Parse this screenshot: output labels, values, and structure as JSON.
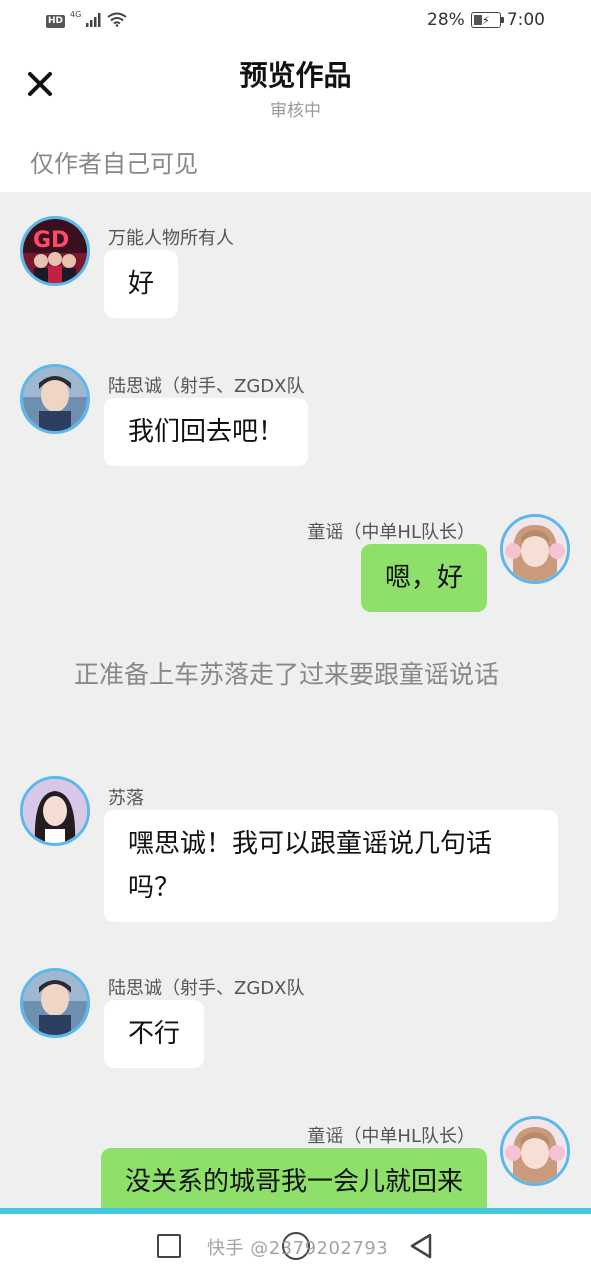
{
  "status_bar": {
    "hd": "HD",
    "network": "4G",
    "battery_percent": "28%",
    "battery_level": 0.28,
    "time": "7:00",
    "icons": [
      "signal-icon",
      "wifi-icon",
      "battery-icon",
      "charging-icon"
    ]
  },
  "header": {
    "close_icon": "close-icon",
    "title": "预览作品",
    "subtitle": "审核中"
  },
  "visibility_note": "仅作者自己可见",
  "colors": {
    "bubble_right": "#8fe06a",
    "bubble_left": "#ffffff",
    "avatar_border": "#5ab8ea",
    "chat_background": "#efefef",
    "accent_line": "#46c6dd"
  },
  "messages": [
    {
      "side": "left",
      "sender": "万能人物所有人",
      "text": "好"
    },
    {
      "side": "left",
      "sender": "陆思诚（射手、ZGDX队",
      "text": "我们回去吧！"
    },
    {
      "side": "right",
      "sender": "童谣（中单HL队长）",
      "text": "嗯，好"
    },
    {
      "type": "narration",
      "text": "正准备上车苏落走了过来要跟童谣说话"
    },
    {
      "side": "left",
      "sender": "苏落",
      "text": "嘿思诚！我可以跟童谣说几句话吗？"
    },
    {
      "side": "left",
      "sender": "陆思诚（射手、ZGDX队",
      "text": "不行"
    },
    {
      "side": "right",
      "sender": "童谣（中单HL队长）",
      "text": "没关系的城哥我一会儿就回来"
    }
  ],
  "nav_bar": {
    "icons": [
      "recent-apps-icon",
      "home-icon",
      "back-icon"
    ],
    "watermark": "快手 @2379202793"
  }
}
